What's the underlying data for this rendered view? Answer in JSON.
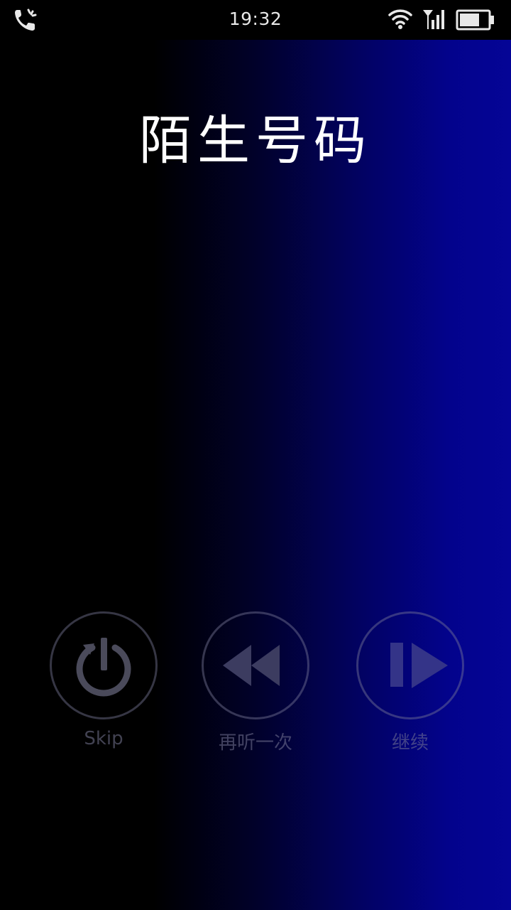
{
  "status_bar": {
    "time": "19:32",
    "left_icon": "call-forward-icon",
    "wifi_icon": "wifi-icon",
    "signal_icon": "cellular-signal-icon",
    "battery_icon": "battery-icon"
  },
  "caller": {
    "title": "陌生号码"
  },
  "actions": {
    "skip": {
      "label": "Skip",
      "icon": "power-restart-icon"
    },
    "replay": {
      "label": "再听一次",
      "icon": "rewind-icon"
    },
    "continue": {
      "label": "继续",
      "icon": "play-pause-icon"
    }
  },
  "colors": {
    "background_left": "#000000",
    "background_right": "#050596",
    "title": "#ffffff",
    "muted_control": "#787896"
  }
}
